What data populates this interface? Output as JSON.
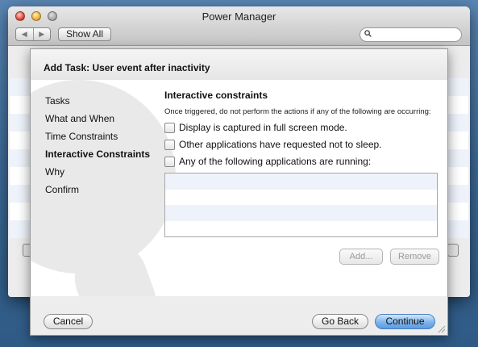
{
  "window": {
    "title": "Power Manager",
    "show_all_label": "Show All",
    "search_placeholder": ""
  },
  "sheet": {
    "title": "Add Task: User event after inactivity",
    "steps": [
      {
        "label": "Tasks",
        "active": false
      },
      {
        "label": "What and When",
        "active": false
      },
      {
        "label": "Time Constraints",
        "active": false
      },
      {
        "label": "Interactive Constraints",
        "active": true
      },
      {
        "label": "Why",
        "active": false
      },
      {
        "label": "Confirm",
        "active": false
      }
    ],
    "section_title": "Interactive constraints",
    "description": "Once triggered, do not perform the actions if any of the following are occurring:",
    "options": [
      {
        "label": "Display is captured in full screen mode.",
        "checked": false
      },
      {
        "label": "Other applications have requested not to sleep.",
        "checked": false
      },
      {
        "label": "Any of the following applications are running:",
        "checked": false
      }
    ],
    "add_label": "Add...",
    "remove_label": "Remove",
    "cancel_label": "Cancel",
    "back_label": "Go Back",
    "continue_label": "Continue"
  }
}
